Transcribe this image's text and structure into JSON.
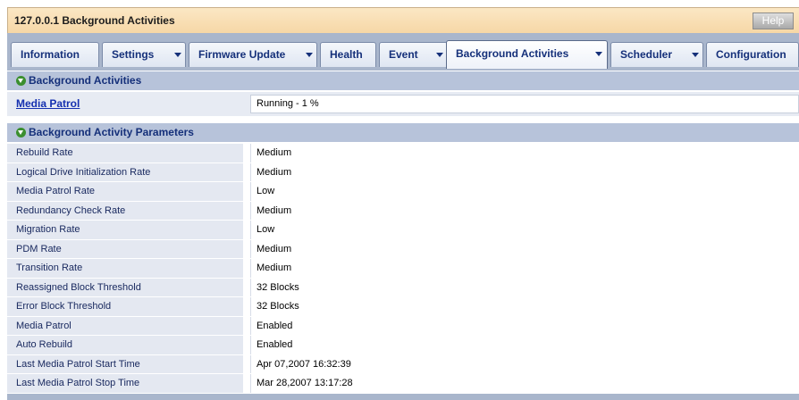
{
  "window": {
    "title": "127.0.0.1 Background Activities",
    "help_label": "Help"
  },
  "tabs": [
    {
      "label": "Information",
      "dropdown": false
    },
    {
      "label": "Settings",
      "dropdown": true
    },
    {
      "label": "Firmware Update",
      "dropdown": true
    },
    {
      "label": "Health",
      "dropdown": false
    },
    {
      "label": "Event",
      "dropdown": true
    },
    {
      "label": "Background Activities",
      "dropdown": true,
      "active": true
    },
    {
      "label": "Scheduler",
      "dropdown": true
    },
    {
      "label": "Configuration",
      "dropdown": false
    }
  ],
  "background_activities": {
    "header": "Background Activities",
    "media_patrol_link": "Media Patrol",
    "media_patrol_status": "Running - 1 %"
  },
  "parameters": {
    "header": "Background Activity Parameters",
    "rows": [
      {
        "label": "Rebuild Rate",
        "value": "Medium"
      },
      {
        "label": "Logical Drive Initialization Rate",
        "value": "Medium"
      },
      {
        "label": "Media Patrol Rate",
        "value": "Low"
      },
      {
        "label": "Redundancy Check Rate",
        "value": "Medium"
      },
      {
        "label": "Migration Rate",
        "value": "Low"
      },
      {
        "label": "PDM Rate",
        "value": "Medium"
      },
      {
        "label": "Transition Rate",
        "value": "Medium"
      },
      {
        "label": "Reassigned Block Threshold",
        "value": "32 Blocks"
      },
      {
        "label": "Error Block Threshold",
        "value": "32 Blocks"
      },
      {
        "label": "Media Patrol",
        "value": "Enabled"
      },
      {
        "label": "Auto Rebuild",
        "value": "Enabled"
      },
      {
        "label": "Last Media Patrol Start Time",
        "value": "Apr 07,2007 16:32:39"
      },
      {
        "label": "Last Media Patrol Stop Time",
        "value": "Mar 28,2007 13:17:28"
      }
    ]
  },
  "colors": {
    "title_bar": "#f6d7a6",
    "tab_bar": "#a9b6cc",
    "section_header": "#b7c3da",
    "label_cell": "#e4e8f1",
    "link": "#1530b0",
    "tab_text": "#15307a",
    "expand_icon": "#3b8f2f"
  }
}
